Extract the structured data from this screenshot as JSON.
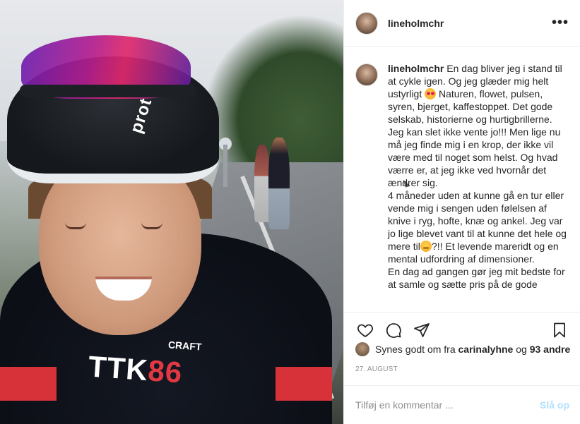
{
  "post": {
    "username": "lineholmchr",
    "more_label": "•••",
    "caption": {
      "username": "lineholmchr",
      "p1a": "En dag bliver jeg i stand til at cykle igen. Og jeg glæder mig helt ustyrligt",
      "p1b": "Naturen, flowet, pulsen, syren, bjerget, kaffestoppet. Det gode selskab, historierne og hurtigbrillerne. Jeg kan slet ikke vente jo!!! Men lige nu må jeg finde mig i en krop, der ikke vil være med til noget som helst. Og hvad værre er, at jeg ikke ved hvornår det ændrer sig.",
      "p2a": "4 måneder uden at kunne gå en tur eller vende mig i sengen uden følelsen af knive i ryg, hofte, knæ og ankel. Jeg var jo lige blevet vant til at kunne det hele og mere til",
      "p2b": "?!! Et levende mareridt og en mental udfordring af dimensioner.",
      "p3": "En dag ad gangen gør jeg mit bedste for at samle og sætte pris på de gode"
    },
    "likes": {
      "prefix": "Synes godt om fra",
      "user": "carinalyhne",
      "connector": "og",
      "others": "93 andre"
    },
    "date": "27. AUGUST",
    "comment": {
      "placeholder": "Tilføj en kommentar ...",
      "post_label": "Slå op"
    }
  },
  "media": {
    "helmet_brand": "prot",
    "jersey_brand": "CRAFT",
    "jersey_text_white": "TTK",
    "jersey_text_red": "86"
  },
  "icons": {
    "like": "heart-icon",
    "comment": "comment-icon",
    "share": "paper-plane-icon",
    "save": "bookmark-icon"
  },
  "colors": {
    "text": "#262626",
    "muted": "#8e8e8e",
    "post_button_disabled": "#b2dffc",
    "border": "#efefef"
  }
}
